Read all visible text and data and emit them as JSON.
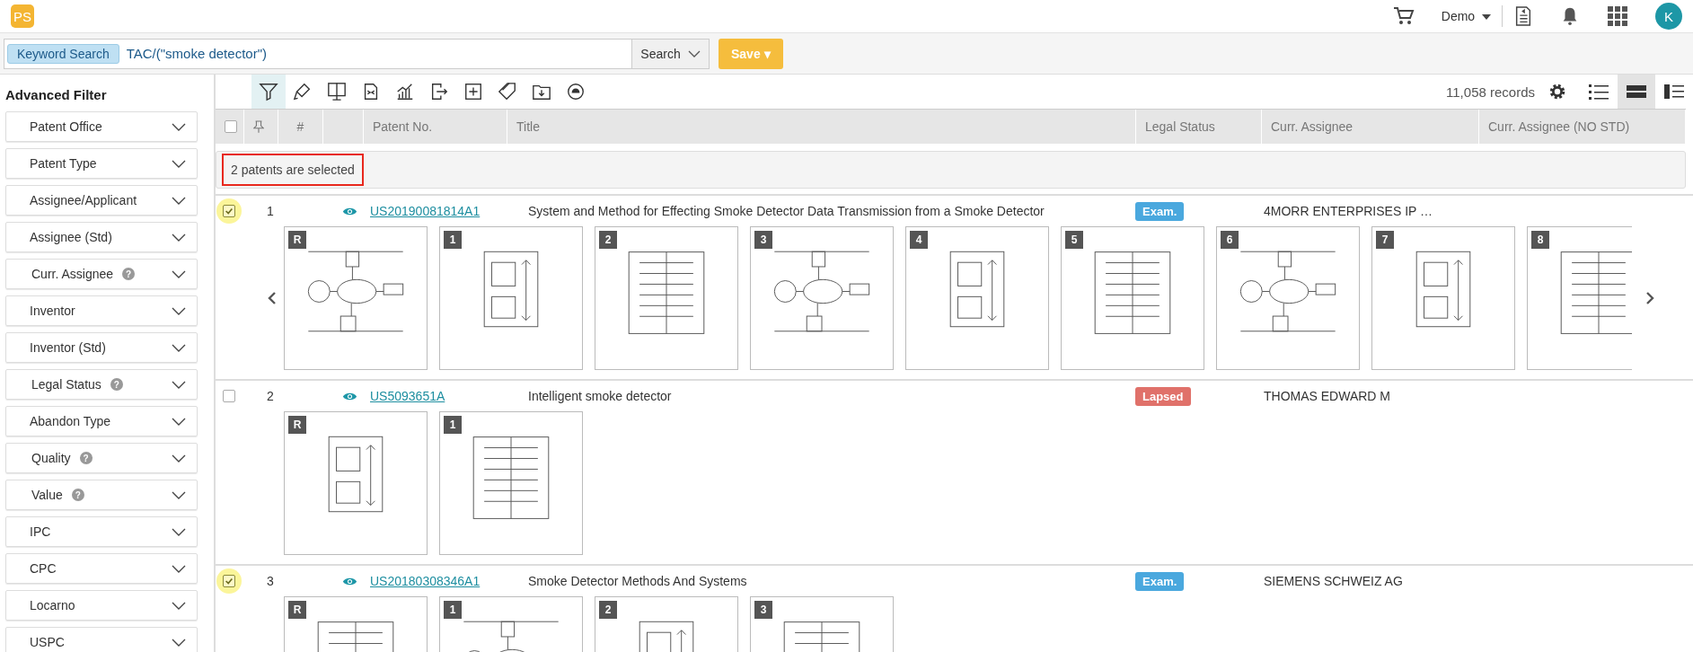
{
  "logo": {
    "text": "PS"
  },
  "header": {
    "user_menu": "Demo",
    "avatar": "K"
  },
  "search": {
    "tag": "Keyword Search",
    "value": "TAC/(\"smoke detector\")",
    "search_button": "Search",
    "save_button": "Save ▾"
  },
  "sidebar": {
    "title": "Advanced Filter",
    "filters": [
      {
        "label": "Patent Office"
      },
      {
        "label": "Patent Type"
      },
      {
        "label": "Assignee/Applicant"
      },
      {
        "label": "Assignee (Std)"
      },
      {
        "label": "Curr. Assignee",
        "help": "?"
      },
      {
        "label": "Inventor"
      },
      {
        "label": "Inventor (Std)"
      },
      {
        "label": "Legal Status",
        "help": "?"
      },
      {
        "label": "Abandon Type"
      },
      {
        "label": "Quality",
        "help": "?"
      },
      {
        "label": "Value",
        "help": "?"
      },
      {
        "label": "IPC"
      },
      {
        "label": "CPC"
      },
      {
        "label": "Locarno"
      },
      {
        "label": "USPC"
      }
    ]
  },
  "toolbar": [
    {
      "kind": "filter",
      "selected": true
    },
    {
      "kind": "highlight",
      "selected": false
    },
    {
      "kind": "monitor",
      "selected": false
    },
    {
      "kind": "compare",
      "selected": false
    },
    {
      "kind": "chart",
      "selected": false
    },
    {
      "kind": "export",
      "selected": false
    },
    {
      "kind": "add",
      "selected": false
    },
    {
      "kind": "tag",
      "selected": false
    },
    {
      "kind": "folder",
      "selected": false
    },
    {
      "kind": "sync",
      "selected": false
    }
  ],
  "records": "11,058 records",
  "view_modes": [
    {
      "kind": "list",
      "selected": false
    },
    {
      "kind": "rows",
      "selected": true
    },
    {
      "kind": "split",
      "selected": false
    }
  ],
  "table": {
    "select_all": {
      "checked": false
    },
    "columns": [
      "#",
      "Patent No.",
      "Title",
      "Legal Status",
      "Curr. Assignee",
      "Curr. Assignee (NO STD)"
    ],
    "selection_notice": "2 patents are selected",
    "rows": [
      {
        "selected": true,
        "number": "1",
        "patent_no": "US20190081814A1",
        "title": "System and Method for Effecting Smoke Detector Data Transmission from a Smoke Detector",
        "legal_status": {
          "label": "Exam.",
          "color": "#4aa8de"
        },
        "assignee": "4MORR ENTERPRISES IP …",
        "carousel": true,
        "thumbnails": [
          "R",
          "1",
          "2",
          "3",
          "4",
          "5",
          "6",
          "7",
          "8"
        ]
      },
      {
        "selected": false,
        "number": "2",
        "patent_no": "US5093651A",
        "title": "Intelligent smoke detector",
        "legal_status": {
          "label": "Lapsed",
          "color": "#e0716a"
        },
        "assignee": "THOMAS EDWARD M",
        "carousel": false,
        "thumbnails": [
          "R",
          "1"
        ]
      },
      {
        "selected": true,
        "number": "3",
        "patent_no": "US20180308346A1",
        "title": "Smoke Detector Methods And Systems",
        "legal_status": {
          "label": "Exam.",
          "color": "#4aa8de"
        },
        "assignee": "SIEMENS SCHWEIZ AG",
        "carousel": false,
        "thumbnails": [
          "R",
          "1",
          "2",
          "3"
        ]
      }
    ]
  }
}
